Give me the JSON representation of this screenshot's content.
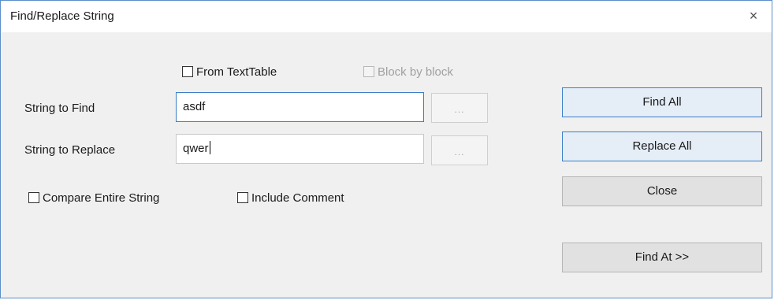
{
  "window": {
    "title": "Find/Replace String",
    "close_glyph": "×"
  },
  "options_top": {
    "from_text_table": {
      "label": "From TextTable",
      "checked": false
    },
    "block_by_block": {
      "label": "Block by block",
      "checked": false,
      "enabled": false
    }
  },
  "find": {
    "label": "String to Find",
    "value": "asdf",
    "browse_label": "..."
  },
  "replace": {
    "label": "String to Replace",
    "value": "qwer",
    "browse_label": "..."
  },
  "options_bottom": {
    "compare_entire": {
      "label": "Compare Entire String",
      "checked": false
    },
    "include_comment": {
      "label": "Include Comment",
      "checked": false
    }
  },
  "buttons": {
    "find_all": "Find All",
    "replace_all": "Replace All",
    "close": "Close",
    "find_at": "Find At >>"
  },
  "colors": {
    "focus_border": "#3c7fc8",
    "window_border": "#5b8fc9",
    "dialog_bg": "#f0f0f0"
  }
}
